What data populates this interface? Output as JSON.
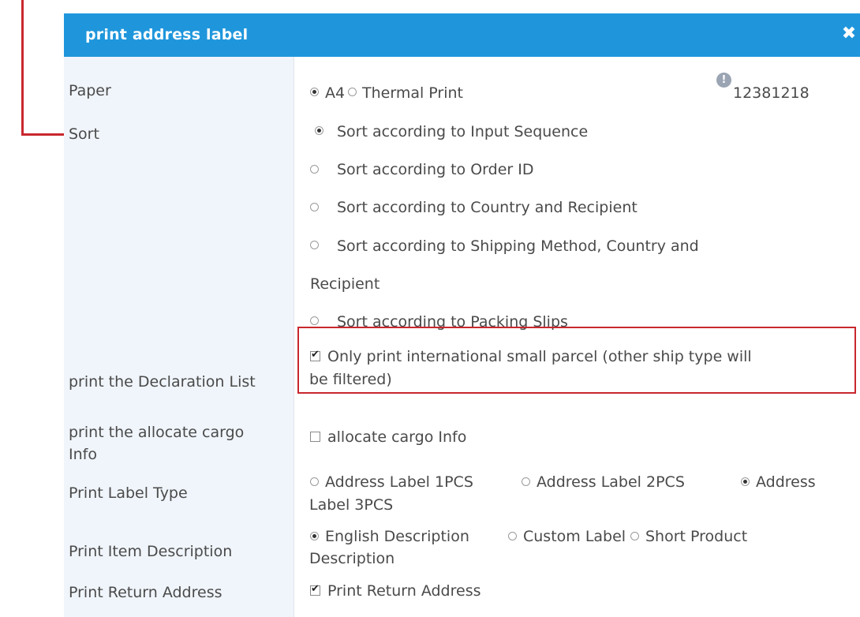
{
  "dialog": {
    "title": "print address label",
    "close_icon": "close-icon"
  },
  "labels": {
    "paper": "Paper",
    "sort": "Sort",
    "declaration": "print the Declaration List",
    "cargo_line1": "print the allocate cargo",
    "cargo_line2": "Info",
    "label_type": "Print Label Type",
    "item_desc": "Print Item Description",
    "return_addr": "Print Return Address"
  },
  "paper": {
    "option_a4": "A4",
    "option_thermal": "Thermal Print",
    "selected": "A4",
    "info_icon": "info-icon",
    "id": "12381218"
  },
  "sort": {
    "selected": "Sort according to Input Sequence",
    "options": [
      "Sort according to Input Sequence",
      "Sort according to Order ID",
      "Sort according to Country and Recipient",
      "Sort according to Shipping Method, Country and",
      "Recipient",
      "Sort according to Packing Slips"
    ]
  },
  "declaration": {
    "checked": true,
    "line1": "Only print international small parcel (other ship type will",
    "line2": "be filtered)"
  },
  "cargo": {
    "checked": false,
    "label": "allocate cargo Info"
  },
  "label_type": {
    "opt1": "Address Label 1PCS",
    "opt2": "Address Label 2PCS",
    "opt3_line1": "Address",
    "opt3_line2": "Label 3PCS",
    "selected": "Address Label 3PCS"
  },
  "item_desc": {
    "opt1": "English Description",
    "opt2": "Custom Label",
    "opt3_line1": "Short Product",
    "opt3_line2": "Description",
    "selected": "English Description"
  },
  "return_addr": {
    "checked": true,
    "label": "Print Return Address"
  },
  "colors": {
    "titlebar": "#1f96dc",
    "annotation": "#c8282e",
    "label_column": "#f0f5fb"
  }
}
